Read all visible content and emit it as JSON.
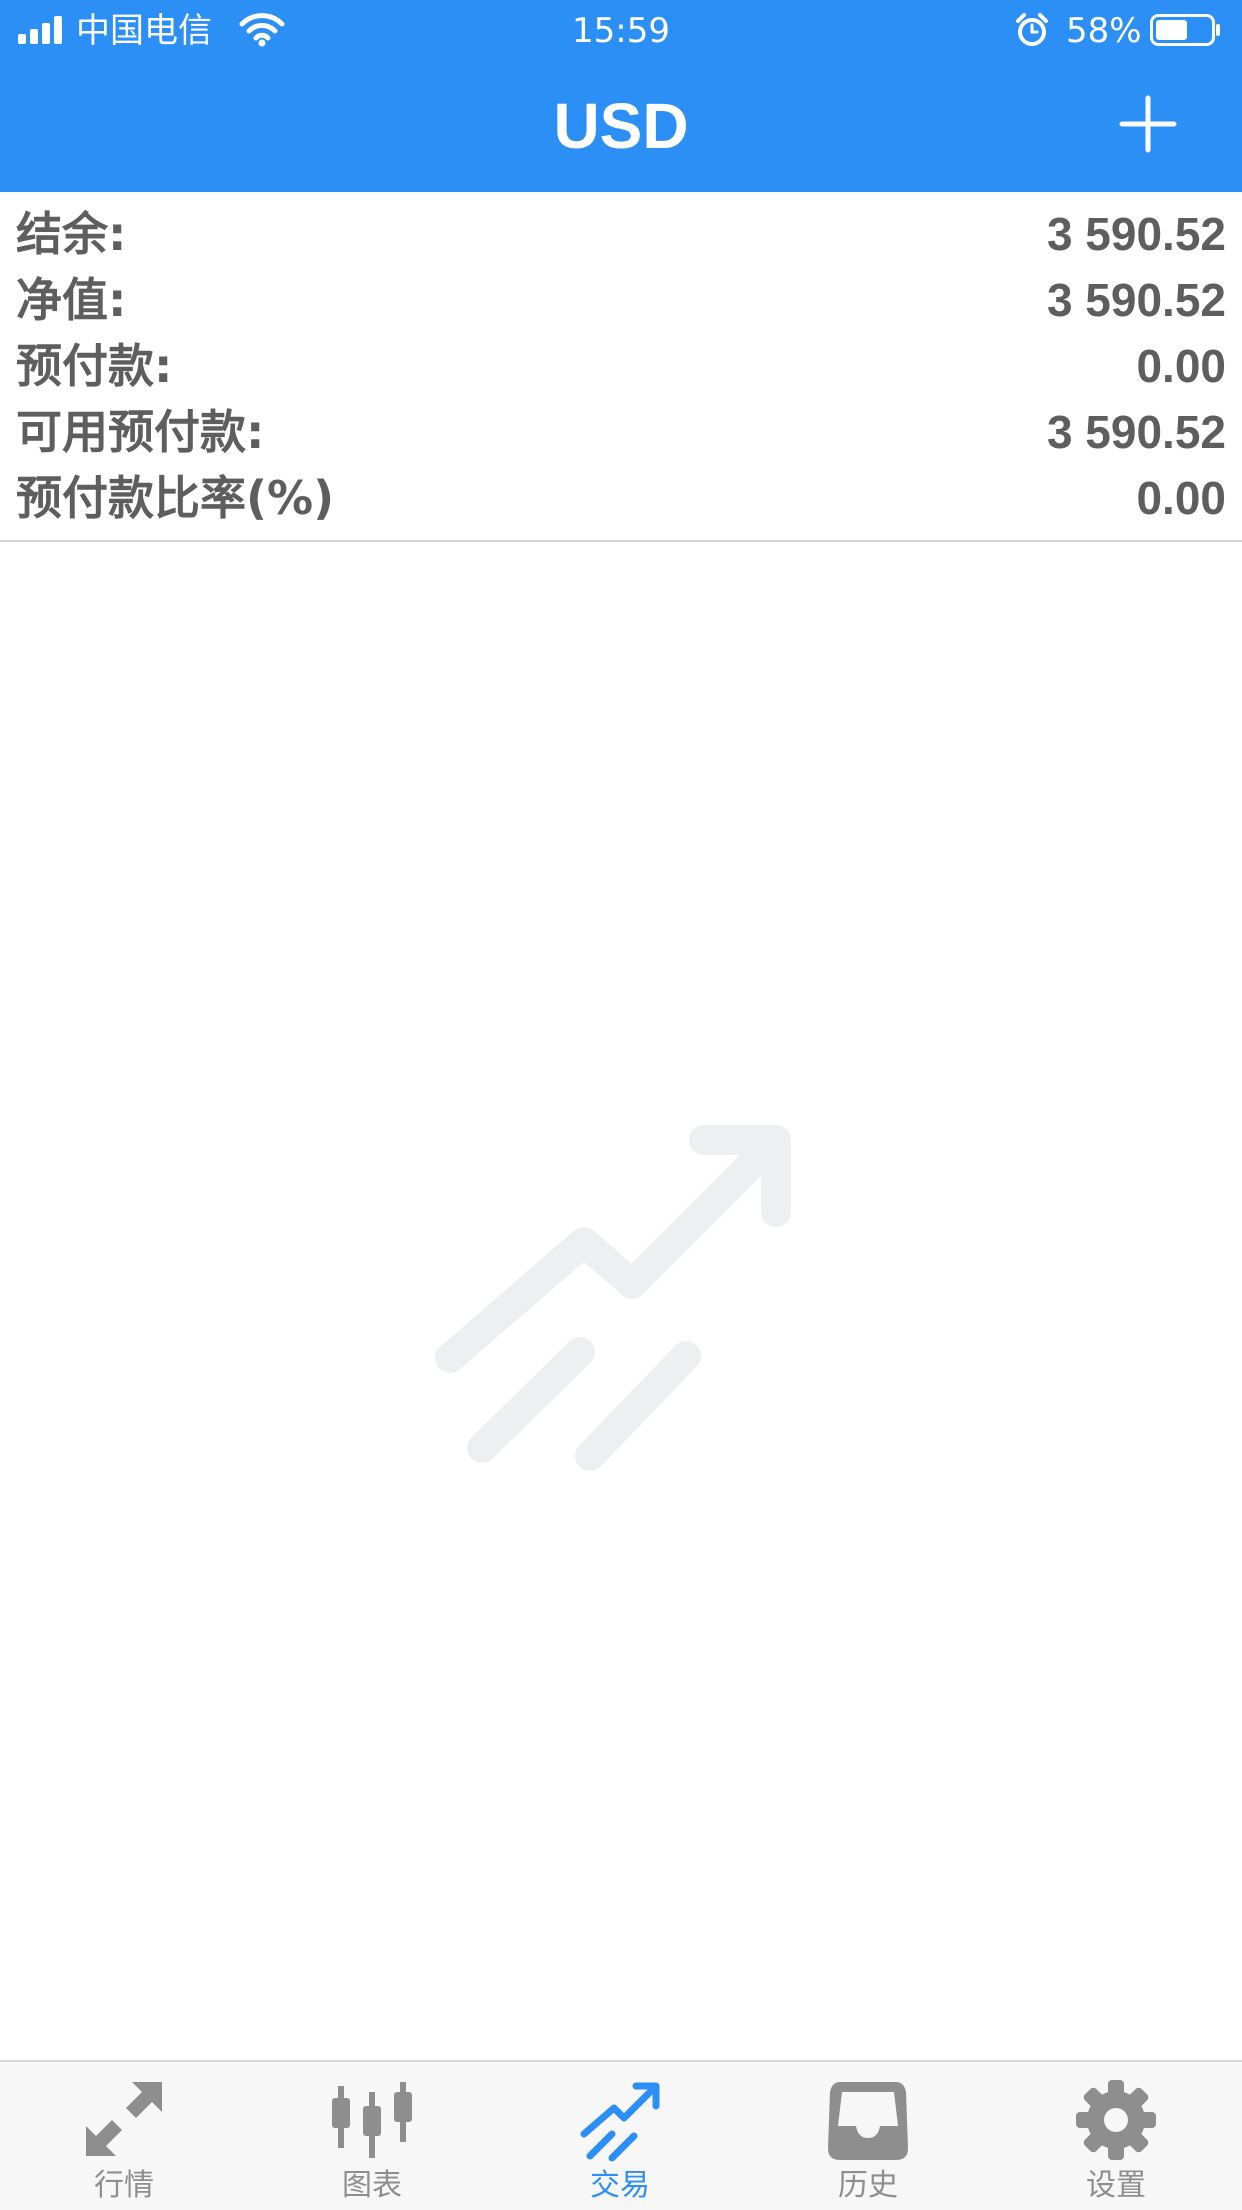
{
  "status_bar": {
    "carrier": "中国电信",
    "time": "15:59",
    "battery": "58%",
    "battery_level": 0.58,
    "icons": [
      "signal-icon",
      "wifi-icon",
      "alarm-icon",
      "battery-icon"
    ]
  },
  "header": {
    "title": "USD",
    "action_icon": "plus-icon"
  },
  "account": {
    "rows": [
      {
        "label": "结余:",
        "value": "3 590.52"
      },
      {
        "label": "净值:",
        "value": "3 590.52"
      },
      {
        "label": "预付款:",
        "value": "0.00"
      },
      {
        "label": "可用预付款:",
        "value": "3 590.52"
      },
      {
        "label": "预付款比率(%)",
        "value": "0.00"
      }
    ]
  },
  "empty_state": {
    "icon": "trade-trend-icon"
  },
  "tabbar": {
    "active_color": "#2b8ff5",
    "inactive_color": "#8e8e8e",
    "tabs": [
      {
        "label": "行情",
        "icon": "quotes-arrows-icon",
        "active": false
      },
      {
        "label": "图表",
        "icon": "candlestick-chart-icon",
        "active": false
      },
      {
        "label": "交易",
        "icon": "trade-trend-icon",
        "active": true
      },
      {
        "label": "历史",
        "icon": "history-inbox-icon",
        "active": false
      },
      {
        "label": "设置",
        "icon": "gear-icon",
        "active": false
      }
    ]
  },
  "colors": {
    "header": "#2b8ff5",
    "text": "#5e5e5e",
    "empty_icon": "#eeeff0"
  }
}
